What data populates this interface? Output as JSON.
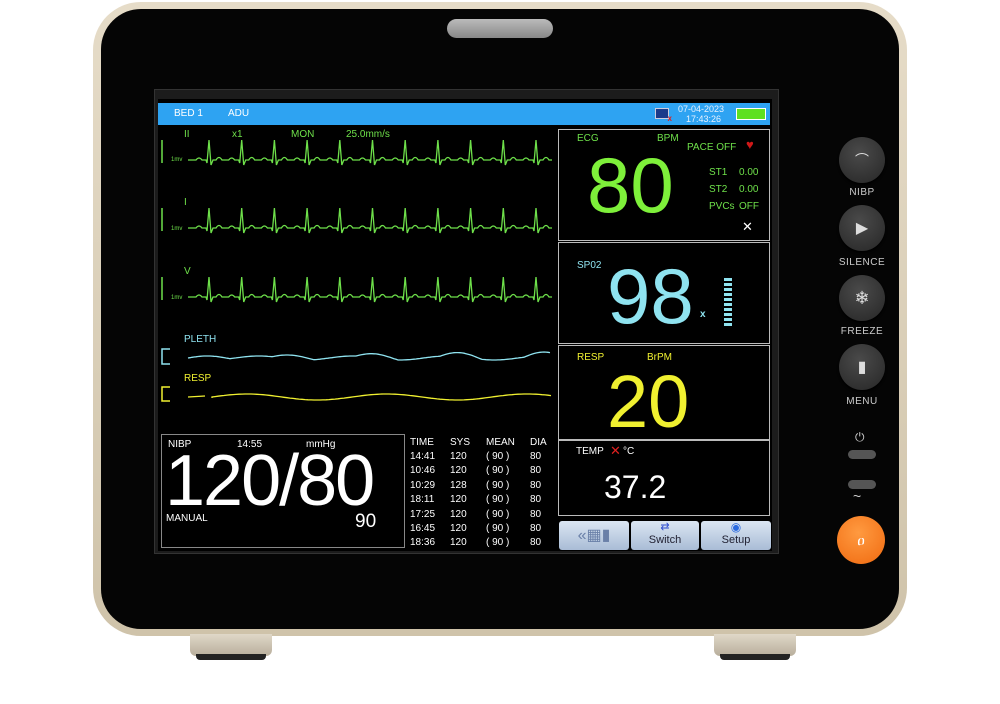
{
  "header": {
    "bed": "BED  1",
    "patient_type": "ADU",
    "date": "07-04-2023",
    "time": "17:43:26",
    "network_icon": "network-disconnected-icon",
    "battery_level": 100
  },
  "ecg_leads": [
    {
      "label": "II",
      "gain": "x1",
      "mode": "MON",
      "speed": "25.0mm/s",
      "scale": "1mv"
    },
    {
      "label": "I",
      "scale": "1mv"
    },
    {
      "label": "V",
      "scale": "1mv"
    }
  ],
  "pleth": {
    "label": "PLETH"
  },
  "resp_wave": {
    "label": "RESP"
  },
  "ecg": {
    "label": "ECG",
    "unit": "BPM",
    "value": "80",
    "pace": "PACE OFF",
    "st1_label": "ST1",
    "st1": "0.00",
    "st2_label": "ST2",
    "st2": "0.00",
    "pvcs_label": "PVCs",
    "pvcs": "OFF"
  },
  "spo2": {
    "label": "SP02",
    "value": "98",
    "mark": "x",
    "bar_level": 1.0
  },
  "resp": {
    "label": "RESP",
    "unit": "BrPM",
    "value": "20"
  },
  "temp": {
    "label": "TEMP",
    "unit": "°C",
    "value": "37.2"
  },
  "nibp": {
    "label": "NIBP",
    "time": "14:55",
    "unit": "mmHg",
    "value": "120/80",
    "mode": "MANUAL",
    "mean": "90"
  },
  "table": {
    "headers": [
      "TIME",
      "SYS",
      "MEAN",
      "DIA"
    ],
    "rows": [
      [
        "14:41",
        "120",
        "( 90 )",
        "80"
      ],
      [
        "10:46",
        "120",
        "( 90 )",
        "80"
      ],
      [
        "10:29",
        "128",
        "( 90 )",
        "80"
      ],
      [
        "18:11",
        "120",
        "( 90 )",
        "80"
      ],
      [
        "17:25",
        "120",
        "( 90 )",
        "80"
      ],
      [
        "16:45",
        "120",
        "( 90 )",
        "80"
      ],
      [
        "18:36",
        "120",
        "( 90 )",
        "80"
      ]
    ]
  },
  "toolbar": {
    "switch": "Switch",
    "setup": "Setup"
  },
  "side_buttons": {
    "nibp": "NIBP",
    "silence": "SILENCE",
    "freeze": "FREEZE",
    "menu": "MENU"
  },
  "colors": {
    "ecg": "#6ee04a",
    "spo2": "#8fe3f0",
    "resp": "#f0f030",
    "header": "#2ea3f2",
    "power_button": "#f57a20"
  }
}
